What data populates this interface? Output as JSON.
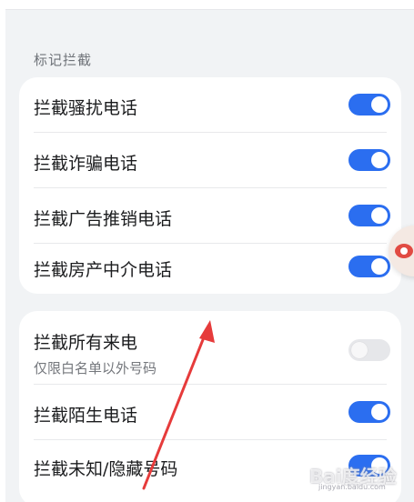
{
  "section_title": "标记拦截",
  "group1": {
    "items": [
      {
        "label": "拦截骚扰电话",
        "toggle": "on"
      },
      {
        "label": "拦截诈骗电话",
        "toggle": "on"
      },
      {
        "label": "拦截广告推销电话",
        "toggle": "on"
      },
      {
        "label": "拦截房产中介电话",
        "toggle": "on"
      }
    ]
  },
  "group2": {
    "items": [
      {
        "label": "拦截所有来电",
        "sublabel": "仅限白名单以外号码",
        "toggle": "off"
      },
      {
        "label": "拦截陌生电话",
        "toggle": "on"
      },
      {
        "label": "拦截未知/隐藏号码",
        "toggle": "on"
      }
    ]
  },
  "colors": {
    "accent": "#2b6ef0",
    "annotation_arrow": "#e63b3b",
    "background": "#f1f3f5"
  },
  "watermark": {
    "text": "Bai度经验",
    "sub": "jingyan.baidu.com"
  }
}
